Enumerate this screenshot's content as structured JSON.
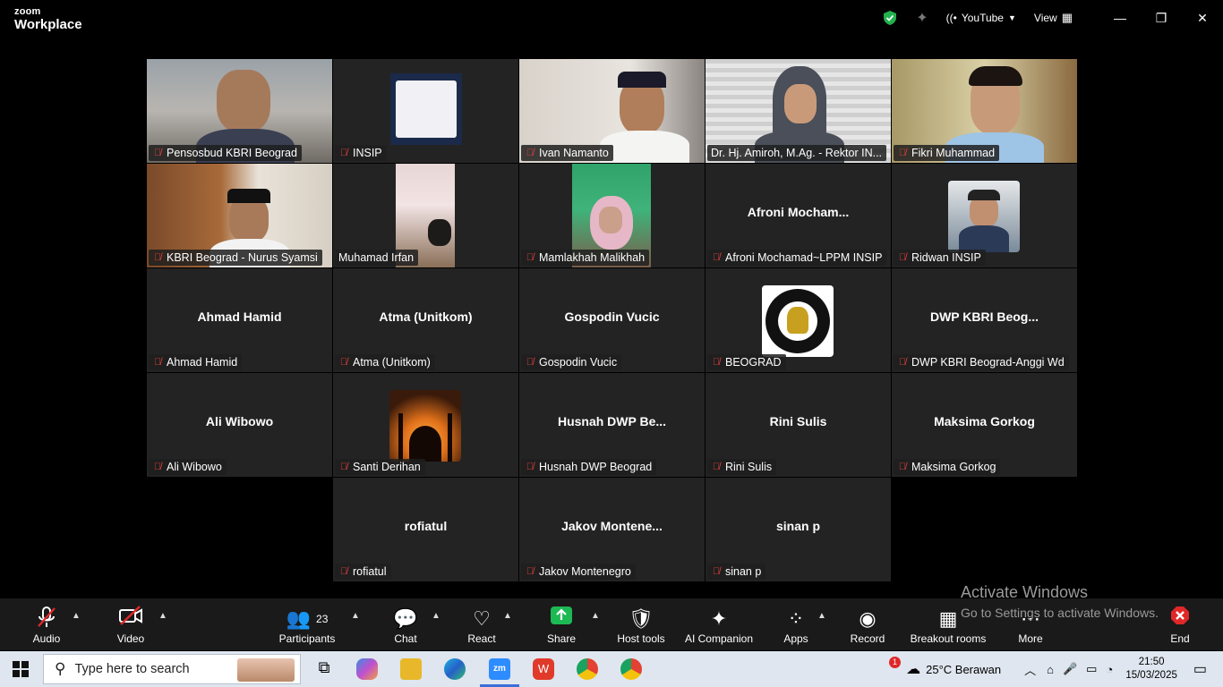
{
  "app": {
    "logo_line1": "zoom",
    "logo_line2": "Workplace"
  },
  "topbar": {
    "stream_label": "YouTube",
    "view_label": "View"
  },
  "tiles": [
    {
      "label": "Pensosbud KBRI Beograd",
      "big": "",
      "muted": true
    },
    {
      "label": "INSIP",
      "big": "",
      "muted": true
    },
    {
      "label": "Ivan Namanto",
      "big": "",
      "muted": true
    },
    {
      "label": "Dr. Hj. Amiroh, M.Ag. - Rektor IN...",
      "big": "",
      "muted": false
    },
    {
      "label": "Fikri Muhammad",
      "big": "",
      "muted": true
    },
    {
      "label": "KBRI Beograd - Nurus Syamsi",
      "big": "",
      "muted": true
    },
    {
      "label": "Muhamad Irfan",
      "big": "",
      "muted": false
    },
    {
      "label": "Mamlakhah Malikhah",
      "big": "",
      "muted": true
    },
    {
      "label": "Afroni Mochamad~LPPM INSIP",
      "big": "Afroni  Mocham...",
      "muted": true
    },
    {
      "label": "Ridwan INSIP",
      "big": "",
      "muted": true
    },
    {
      "label": "Ahmad Hamid",
      "big": "Ahmad Hamid",
      "muted": true
    },
    {
      "label": "Atma (Unitkom)",
      "big": "Atma (Unitkom)",
      "muted": true
    },
    {
      "label": "Gospodin Vucic",
      "big": "Gospodin Vucic",
      "muted": true
    },
    {
      "label": "BEOGRAD",
      "big": "",
      "muted": true
    },
    {
      "label": "DWP KBRI Beograd-Anggi Wd",
      "big": "DWP  KBRI  Beog...",
      "muted": true
    },
    {
      "label": "Ali Wibowo",
      "big": "Ali Wibowo",
      "muted": true
    },
    {
      "label": "Santi Derihan",
      "big": "",
      "muted": true
    },
    {
      "label": "Husnah DWP Beograd",
      "big": "Husnah  DWP  Be...",
      "muted": true
    },
    {
      "label": "Rini Sulis",
      "big": "Rini Sulis",
      "muted": true
    },
    {
      "label": "Maksima Gorkog",
      "big": "Maksima Gorkog",
      "muted": true
    },
    {
      "label": "rofiatul",
      "big": "rofiatul",
      "muted": true
    },
    {
      "label": "Jakov Montenegro",
      "big": "Jakov  Montene...",
      "muted": true
    },
    {
      "label": "sinan p",
      "big": "sinan p",
      "muted": true
    }
  ],
  "toolbar": {
    "audio": "Audio",
    "video": "Video",
    "participants": "Participants",
    "participants_count": "23",
    "chat": "Chat",
    "react": "React",
    "share": "Share",
    "host_tools": "Host tools",
    "ai_companion": "AI Companion",
    "apps": "Apps",
    "record": "Record",
    "breakout": "Breakout rooms",
    "more": "More",
    "end": "End"
  },
  "watermark": {
    "title": "Activate Windows",
    "subtitle": "Go to Settings to activate Windows."
  },
  "taskbar": {
    "search_placeholder": "Type here to search",
    "weather": "25°C  Berawan",
    "time": "21:50",
    "date": "15/03/2025",
    "notif_count": "1"
  },
  "colors": {
    "active_speaker": "#39c26b",
    "share_green": "#1db954",
    "end_red": "#e02828",
    "mute_red": "#e8413b"
  }
}
